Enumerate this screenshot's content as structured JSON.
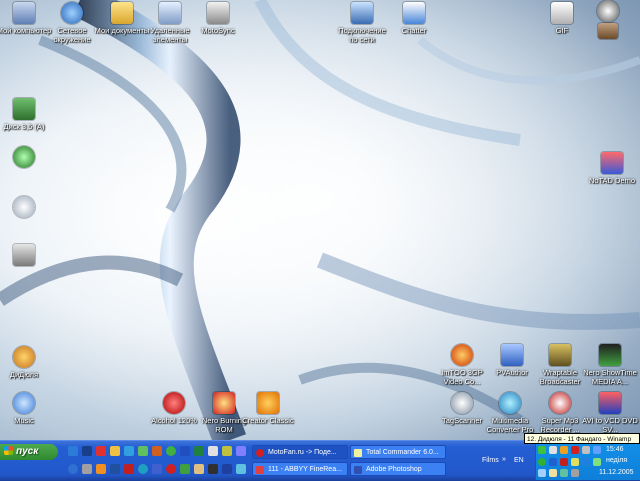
{
  "desktop_icons": [
    {
      "label": "Мой компьютер",
      "icon": "my-computer-icon"
    },
    {
      "label": "Сетевое окружение",
      "icon": "network-icon"
    },
    {
      "label": "Мои документы",
      "icon": "my-documents-icon"
    },
    {
      "label": "Удаленные элементы",
      "icon": "recycle-bin-icon"
    },
    {
      "label": "MotoSync",
      "icon": "motosync-icon"
    },
    {
      "label": "Подключение по сети",
      "icon": "network-connection-icon"
    },
    {
      "label": "Chatter",
      "icon": "chatter-icon"
    },
    {
      "label": "GIF",
      "icon": "gif-icon"
    },
    {
      "label": "",
      "icon": "motorola-icon"
    },
    {
      "label": "Диск 3,5 (A)",
      "icon": "floppy-icon"
    },
    {
      "label": "",
      "icon": "joystick-icon"
    },
    {
      "label": "",
      "icon": "cd-drive-icon"
    },
    {
      "label": "",
      "icon": "usb-drive-icon"
    },
    {
      "label": "NoTAD Demo",
      "icon": "notad-icon"
    },
    {
      "label": "ДиДюля",
      "icon": "didyulya-icon"
    },
    {
      "label": "ImTOO 3GP Video Co...",
      "icon": "imtoo-icon"
    },
    {
      "label": "PVAuthor",
      "icon": "pvauthor-icon"
    },
    {
      "label": "Wraptable Broadcaster",
      "icon": "broadcaster-icon"
    },
    {
      "label": "Nero ShowTime MEDIA A...",
      "icon": "media-icon"
    },
    {
      "label": "Music",
      "icon": "music-icon"
    },
    {
      "label": "Alcohol 120%",
      "icon": "alcohol-icon"
    },
    {
      "label": "Nero Burning ROM",
      "icon": "nero-icon"
    },
    {
      "label": "Creator Classic",
      "icon": "creator-icon"
    },
    {
      "label": "TagScanner",
      "icon": "tagscanner-icon"
    },
    {
      "label": "Multimedia Converter Pro",
      "icon": "converter-icon"
    },
    {
      "label": "Super Mp3 Recorder ...",
      "icon": "recorder-icon"
    },
    {
      "label": "AVI to VCD DVD SV...",
      "icon": "avi-icon"
    }
  ],
  "taskbar": {
    "start_label": "пуск",
    "tasks": [
      {
        "label": "MotoFan.ru -> Поде..."
      },
      {
        "label": "Total Commander 6.0..."
      },
      {
        "label": "111 - ABBYY FineRea..."
      },
      {
        "label": "Adobe Photoshop"
      }
    ],
    "films_label": "Films",
    "lang": "EN",
    "time": "15:46",
    "day": "неділя",
    "date": "11.12.2005",
    "tooltip": "12. Дидюля - 11 Фандаго - Winamp"
  },
  "colors": {
    "taskbar": "#245ed4",
    "start": "#2f8a2f",
    "tray": "#1290e8",
    "tooltip_bg": "#ffffe1"
  }
}
